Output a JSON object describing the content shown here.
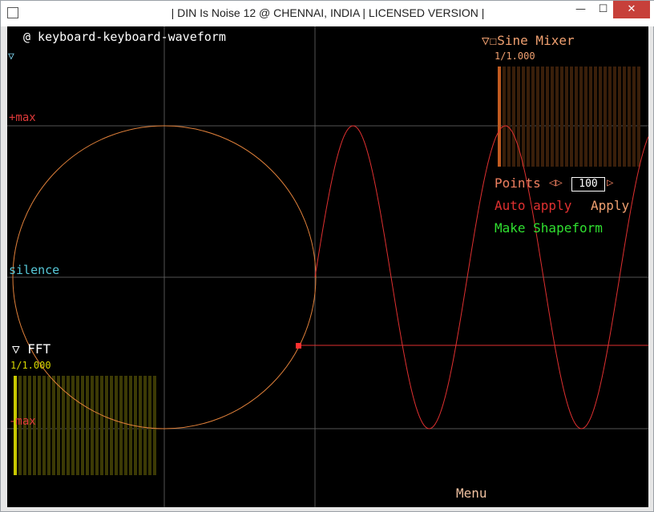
{
  "window": {
    "title": "| DIN Is Noise 12 @ CHENNAI, INDIA | LICENSED VERSION |",
    "controls": {
      "minimize": "—",
      "maximize": "☐",
      "close": "✕"
    }
  },
  "canvas": {
    "top_label": "@ keyboard-keyboard-waveform",
    "nav_arrow": "▽",
    "level_labels": {
      "max_plus": "+max",
      "silence": "silence",
      "max_minus": "-max"
    }
  },
  "fft": {
    "title": "▽ FFT",
    "ratio": "1/1.000",
    "color": "#d8d800",
    "first_bar_level": 1.0
  },
  "sine_mixer": {
    "title": "▽☐Sine Mixer",
    "ratio": "1/1.000",
    "color": "#d06020",
    "first_bar_level": 1.0,
    "points_label": "Points",
    "points_arrows": "◁▷",
    "points_value": "100",
    "points_right_arrow": "▷",
    "auto_apply_label": "Auto apply",
    "apply_label": "Apply",
    "make_shapeform_label": "Make Shapeform"
  },
  "menu_label": "Menu",
  "colors": {
    "background": "#000000",
    "grid": "#555555",
    "wave": "#e03030",
    "circle": "#e0803a",
    "marker": "#ff3030"
  }
}
